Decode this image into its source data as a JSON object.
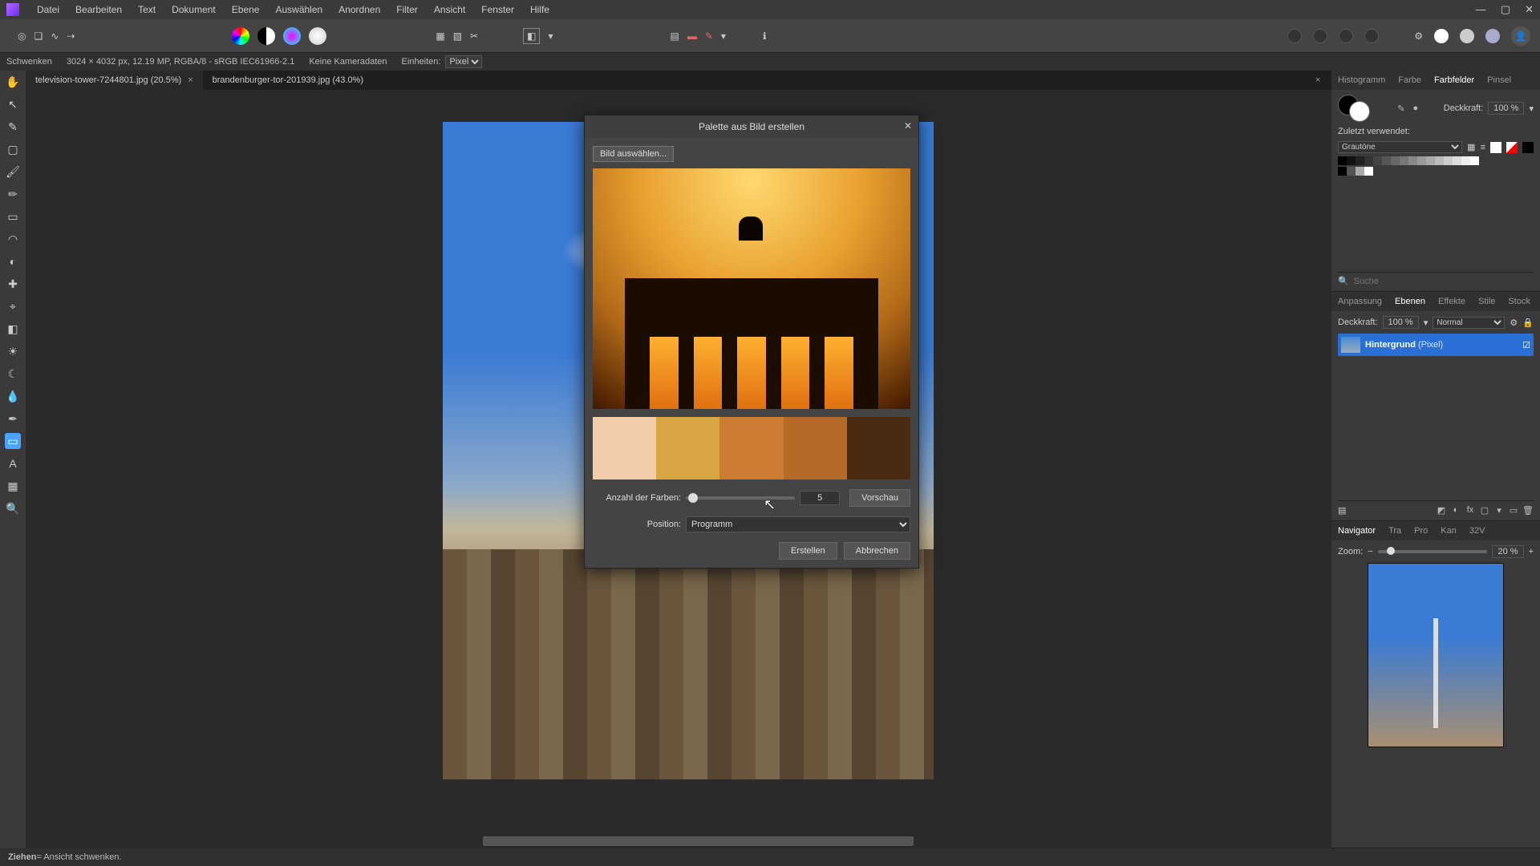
{
  "menu": [
    "Datei",
    "Bearbeiten",
    "Text",
    "Dokument",
    "Ebene",
    "Auswählen",
    "Anordnen",
    "Filter",
    "Ansicht",
    "Fenster",
    "Hilfe"
  ],
  "info": {
    "tool": "Schwenken",
    "dims": "3024 × 4032 px, 12.19 MP, RGBA/8 - sRGB IEC61966-2.1",
    "camera": "Keine Kameradaten",
    "units_label": "Einheiten:",
    "units_value": "Pixel"
  },
  "tabs": [
    {
      "label": "television-tower-7244801.jpg (20.5%)",
      "active": true
    },
    {
      "label": "brandenburger-tor-201939.jpg (43.0%)",
      "active": false
    }
  ],
  "dialog": {
    "title": "Palette aus Bild erstellen",
    "select_image": "Bild auswählen...",
    "count_label": "Anzahl der Farben:",
    "count_value": "5",
    "preview_btn": "Vorschau",
    "position_label": "Position:",
    "position_value": "Programm",
    "create": "Erstellen",
    "cancel": "Abbrechen",
    "palette": [
      "#f0cda8",
      "#d8a642",
      "#cc7d33",
      "#b56a2a",
      "#4a2a10"
    ]
  },
  "swatches": {
    "opacity_label": "Deckkraft:",
    "opacity_value": "100 %",
    "recent_label": "Zuletzt verwendet:",
    "set_name": "Grautöne",
    "tabs": [
      "Histogramm",
      "Farbe",
      "Farbfelder",
      "Pinsel"
    ],
    "greys": [
      "#000",
      "#111",
      "#222",
      "#333",
      "#444",
      "#555",
      "#666",
      "#777",
      "#888",
      "#999",
      "#aaa",
      "#bbb",
      "#ccc",
      "#ddd",
      "#eee",
      "#fff"
    ],
    "row2": [
      "#000",
      "#555",
      "#aaa",
      "#fff"
    ]
  },
  "search_placeholder": "Suche",
  "layers": {
    "tabs": [
      "Anpassung",
      "Ebenen",
      "Effekte",
      "Stile",
      "Stock"
    ],
    "opacity_label": "Deckkraft:",
    "opacity_value": "100 %",
    "blend": "Normal",
    "layer_name": "Hintergrund",
    "layer_type": "(Pixel)"
  },
  "nav": {
    "tabs": [
      "Navigator",
      "Tra",
      "Pro",
      "Kan",
      "32V"
    ],
    "zoom_label": "Zoom:",
    "zoom_value": "20 %"
  },
  "status": {
    "action": "Ziehen",
    "desc": " = Ansicht schwenken."
  }
}
